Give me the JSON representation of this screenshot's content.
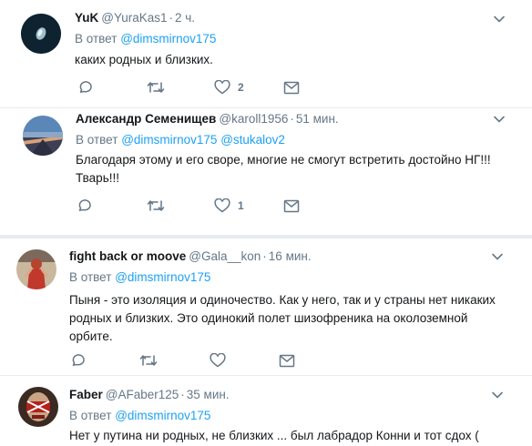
{
  "reply_prefix": "В ответ",
  "tweets": [
    {
      "name": "YuK",
      "handle": "@YuraKas1",
      "time": "2 ч.",
      "mentions": [
        "@dimsmirnov175"
      ],
      "text": "каких родных и близких.",
      "likes": "2"
    },
    {
      "name": "Александр Семенищев",
      "handle": "@karoll1956",
      "time": "51 мин.",
      "mentions": [
        "@dimsmirnov175",
        "@stukalov2"
      ],
      "text": "Благодаря этому и его своре, многие не смогут встретить достойно НГ!!! Тварь!!!",
      "likes": "1"
    },
    {
      "name": "fight back or moove",
      "handle": "@Gala__kon",
      "time": "16 мин.",
      "mentions": [
        "@dimsmirnov175"
      ],
      "text": "Пыня - это изоляция и одиночество. Как у него, так и у страны нет никаких родных и близких. Это одинокий полет шизофреника на околоземной орбите.",
      "likes": ""
    },
    {
      "name": "Faber",
      "handle": "@AFaber125",
      "time": "35 мин.",
      "mentions": [
        "@dimsmirnov175"
      ],
      "text": "Нет у путина ни родных, не близких ... был лабрадор Конни и тот сдох (",
      "likes": ""
    }
  ],
  "icons": {
    "reply": "reply-icon",
    "retweet": "retweet-icon",
    "like": "heart-icon",
    "dm": "envelope-icon",
    "more": "chevron-down-icon"
  },
  "colors": {
    "link": "#1da1f2",
    "muted": "#657786",
    "text": "#14171a",
    "divider": "#e6ecf0"
  }
}
